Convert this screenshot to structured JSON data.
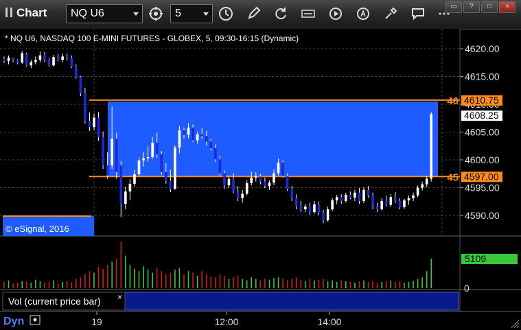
{
  "toolbar": {
    "title": "Chart",
    "symbol": "NQ U6",
    "interval": "5",
    "icons": [
      "link-icon",
      "interval-icon",
      "clock-icon",
      "pencil-icon",
      "cursor-icon",
      "get-icon",
      "play-icon",
      "alert-icon",
      "tools-icon",
      "comment-icon"
    ],
    "window_buttons": [
      "restore-icon",
      "help-icon",
      "maximize-icon",
      "close-icon"
    ]
  },
  "chart": {
    "header": "* NQ U6, NASDAQ 100 E-MINI FUTURES - GLOBEX, 5, 09:30-16:15 (Dynamic)",
    "copyright": "© eSignal, 2016",
    "price_ticks": [
      "4620.00",
      "4615.00",
      "4610.00",
      "4605.00",
      "4600.00",
      "4595.00",
      "4590.00"
    ],
    "upper_level_tag": "46",
    "upper_level_price": "4610.75",
    "last_price": "4608.25",
    "lower_level_tag": "45",
    "lower_level_price": "4597.00",
    "colors": {
      "zone": "#1e5cff",
      "level": "#ff8c1a",
      "down_bar": "#1a2ad8",
      "up_bar": "#ffffff",
      "vol_up": "#37c837",
      "vol_down": "#d01c1c"
    }
  },
  "volume": {
    "label": "Vol (current price bar)",
    "close_glyph": "×",
    "last_value": "5109",
    "zero_tick": "0"
  },
  "time_axis": {
    "dyn_label": "Dyn",
    "ticks": [
      "19",
      "12:00",
      "14:00"
    ]
  },
  "chart_data": {
    "type": "candlestick",
    "y_range": [
      4587,
      4623
    ],
    "upper_level": 4610.75,
    "lower_level": 4597.0,
    "last": 4608.25,
    "candles": [
      [
        4618.2,
        4618.6,
        4617.4,
        4617.8
      ],
      [
        4617.8,
        4618.8,
        4617.2,
        4618.4
      ],
      [
        4618.2,
        4618.4,
        4617.6,
        4617.9
      ],
      [
        4617.9,
        4618.1,
        4617.2,
        4617.5
      ],
      [
        4617.5,
        4619.6,
        4617.3,
        4619.2
      ],
      [
        4619.0,
        4619.3,
        4616.8,
        4617.0
      ],
      [
        4617.0,
        4618.0,
        4616.5,
        4617.6
      ],
      [
        4617.6,
        4618.6,
        4617.2,
        4618.0
      ],
      [
        4618.0,
        4619.5,
        4617.6,
        4618.8
      ],
      [
        4618.8,
        4619.4,
        4617.6,
        4618.0
      ],
      [
        4618.0,
        4618.3,
        4616.7,
        4617.0
      ],
      [
        4617.0,
        4618.9,
        4616.8,
        4618.5
      ],
      [
        4618.5,
        4619.0,
        4617.7,
        4618.0
      ],
      [
        4618.0,
        4619.1,
        4617.6,
        4618.6
      ],
      [
        4618.6,
        4619.1,
        4617.9,
        4618.3
      ],
      [
        4618.3,
        4618.8,
        4616.5,
        4616.8
      ],
      [
        4616.8,
        4617.2,
        4614.6,
        4614.9
      ],
      [
        4614.9,
        4615.1,
        4611.5,
        4612.0
      ],
      [
        4612.0,
        4613.0,
        4606.5,
        4607.0
      ],
      [
        4607.0,
        4608.5,
        4605.2,
        4605.9
      ],
      [
        4605.9,
        4608.3,
        4605.3,
        4607.6
      ],
      [
        4607.6,
        4608.6,
        4603.4,
        4604.1
      ],
      [
        4604.1,
        4605.1,
        4598.4,
        4599.0
      ],
      [
        4599.0,
        4601.4,
        4596.6,
        4597.2
      ],
      [
        4599.0,
        4609.6,
        4598.4,
        4603.8
      ],
      [
        4603.8,
        4604.9,
        4596.6,
        4597.8
      ],
      [
        4599.0,
        4599.8,
        4589.7,
        4592.1
      ],
      [
        4592.1,
        4595.2,
        4591.1,
        4594.3
      ],
      [
        4594.3,
        4596.5,
        4592.8,
        4595.7
      ],
      [
        4595.7,
        4598.2,
        4595.2,
        4597.4
      ],
      [
        4597.4,
        4600.5,
        4597.1,
        4599.9
      ],
      [
        4599.9,
        4601.4,
        4598.8,
        4600.3
      ],
      [
        4600.3,
        4602.5,
        4599.6,
        4600.5
      ],
      [
        4600.5,
        4604.1,
        4600.2,
        4603.1
      ],
      [
        4603.1,
        4604.9,
        4600.4,
        4601.0
      ],
      [
        4601.0,
        4601.6,
        4597.3,
        4597.8
      ],
      [
        4597.8,
        4599.4,
        4595.7,
        4596.2
      ],
      [
        4596.2,
        4598.2,
        4594.2,
        4594.8
      ],
      [
        4594.8,
        4602.6,
        4594.6,
        4602.2
      ],
      [
        4602.2,
        4606.1,
        4601.2,
        4605.3
      ],
      [
        4605.3,
        4605.8,
        4603.9,
        4604.5
      ],
      [
        4604.5,
        4606.6,
        4603.9,
        4605.8
      ],
      [
        4605.8,
        4606.4,
        4603.2,
        4603.5
      ],
      [
        4603.5,
        4605.1,
        4602.9,
        4604.6
      ],
      [
        4604.6,
        4605.7,
        4603.8,
        4604.3
      ],
      [
        4604.3,
        4605.2,
        4602.6,
        4603.3
      ],
      [
        4603.3,
        4603.8,
        4601.6,
        4602.1
      ],
      [
        4602.1,
        4602.8,
        4599.6,
        4600.1
      ],
      [
        4600.1,
        4600.8,
        4597.1,
        4597.6
      ],
      [
        4597.6,
        4598.1,
        4594.8,
        4595.4
      ],
      [
        4595.4,
        4597.2,
        4594.9,
        4596.6
      ],
      [
        4596.6,
        4597.6,
        4594.0,
        4594.3
      ],
      [
        4594.3,
        4595.3,
        4592.6,
        4593.1
      ],
      [
        4593.1,
        4594.6,
        4592.3,
        4593.9
      ],
      [
        4593.9,
        4596.3,
        4593.6,
        4595.8
      ],
      [
        4595.8,
        4597.9,
        4595.4,
        4596.8
      ],
      [
        4596.8,
        4597.8,
        4596.1,
        4597.0
      ],
      [
        4597.0,
        4597.5,
        4595.6,
        4596.1
      ],
      [
        4596.1,
        4596.8,
        4594.9,
        4595.3
      ],
      [
        4595.3,
        4596.3,
        4594.6,
        4595.9
      ],
      [
        4595.9,
        4598.3,
        4595.5,
        4597.6
      ],
      [
        4597.6,
        4600.2,
        4597.2,
        4599.5
      ],
      [
        4599.5,
        4599.9,
        4596.8,
        4597.1
      ],
      [
        4597.1,
        4597.6,
        4594.4,
        4594.8
      ],
      [
        4594.8,
        4595.3,
        4592.6,
        4593.1
      ],
      [
        4593.1,
        4593.8,
        4591.1,
        4591.7
      ],
      [
        4591.7,
        4592.6,
        4590.6,
        4591.1
      ],
      [
        4591.1,
        4592.1,
        4590.6,
        4591.6
      ],
      [
        4591.6,
        4592.3,
        4590.1,
        4590.6
      ],
      [
        4590.6,
        4592.6,
        4590.3,
        4592.0
      ],
      [
        4592.0,
        4592.5,
        4590.1,
        4590.5
      ],
      [
        4590.5,
        4591.0,
        4588.6,
        4589.1
      ],
      [
        4589.1,
        4591.6,
        4588.9,
        4591.1
      ],
      [
        4591.1,
        4593.1,
        4590.8,
        4592.7
      ],
      [
        4592.7,
        4593.7,
        4592.0,
        4593.3
      ],
      [
        4593.3,
        4593.8,
        4592.1,
        4592.6
      ],
      [
        4592.6,
        4594.1,
        4592.3,
        4593.7
      ],
      [
        4593.7,
        4594.3,
        4592.9,
        4593.2
      ],
      [
        4593.2,
        4594.6,
        4592.6,
        4594.1
      ],
      [
        4594.1,
        4594.9,
        4592.1,
        4592.6
      ],
      [
        4592.6,
        4595.1,
        4592.2,
        4594.6
      ],
      [
        4594.6,
        4595.3,
        4593.2,
        4593.6
      ],
      [
        4593.6,
        4594.1,
        4591.1,
        4591.6
      ],
      [
        4591.6,
        4592.3,
        4590.6,
        4591.1
      ],
      [
        4591.1,
        4593.1,
        4590.9,
        4592.6
      ],
      [
        4592.6,
        4593.6,
        4591.6,
        4591.9
      ],
      [
        4591.9,
        4593.8,
        4591.5,
        4593.3
      ],
      [
        4593.3,
        4594.2,
        4592.2,
        4592.6
      ],
      [
        4592.6,
        4593.1,
        4591.1,
        4591.5
      ],
      [
        4591.5,
        4593.0,
        4591.2,
        4592.7
      ],
      [
        4592.7,
        4593.6,
        4591.9,
        4593.1
      ],
      [
        4593.1,
        4594.1,
        4592.6,
        4593.6
      ],
      [
        4593.6,
        4595.4,
        4593.3,
        4595.0
      ],
      [
        4595.0,
        4596.1,
        4594.5,
        4595.6
      ],
      [
        4595.6,
        4597.1,
        4595.1,
        4596.6
      ],
      [
        4596.6,
        4608.6,
        4596.1,
        4608.25
      ]
    ],
    "volume": [
      8,
      10,
      6,
      7,
      9,
      8,
      7,
      11,
      9,
      7,
      8,
      10,
      6,
      8,
      9,
      7,
      12,
      14,
      18,
      22,
      20,
      28,
      25,
      30,
      34,
      38,
      60,
      42,
      30,
      25,
      22,
      28,
      24,
      20,
      26,
      22,
      18,
      20,
      24,
      26,
      18,
      22,
      20,
      16,
      22,
      18,
      15,
      14,
      18,
      16,
      12,
      14,
      16,
      12,
      10,
      14,
      12,
      10,
      12,
      11,
      13,
      14,
      12,
      10,
      12,
      14,
      11,
      9,
      12,
      10,
      11,
      12,
      9,
      10,
      8,
      10,
      9,
      8,
      7,
      9,
      10,
      8,
      9,
      7,
      8,
      9,
      10,
      8,
      9,
      7,
      8,
      9,
      12,
      14,
      22,
      38
    ]
  }
}
